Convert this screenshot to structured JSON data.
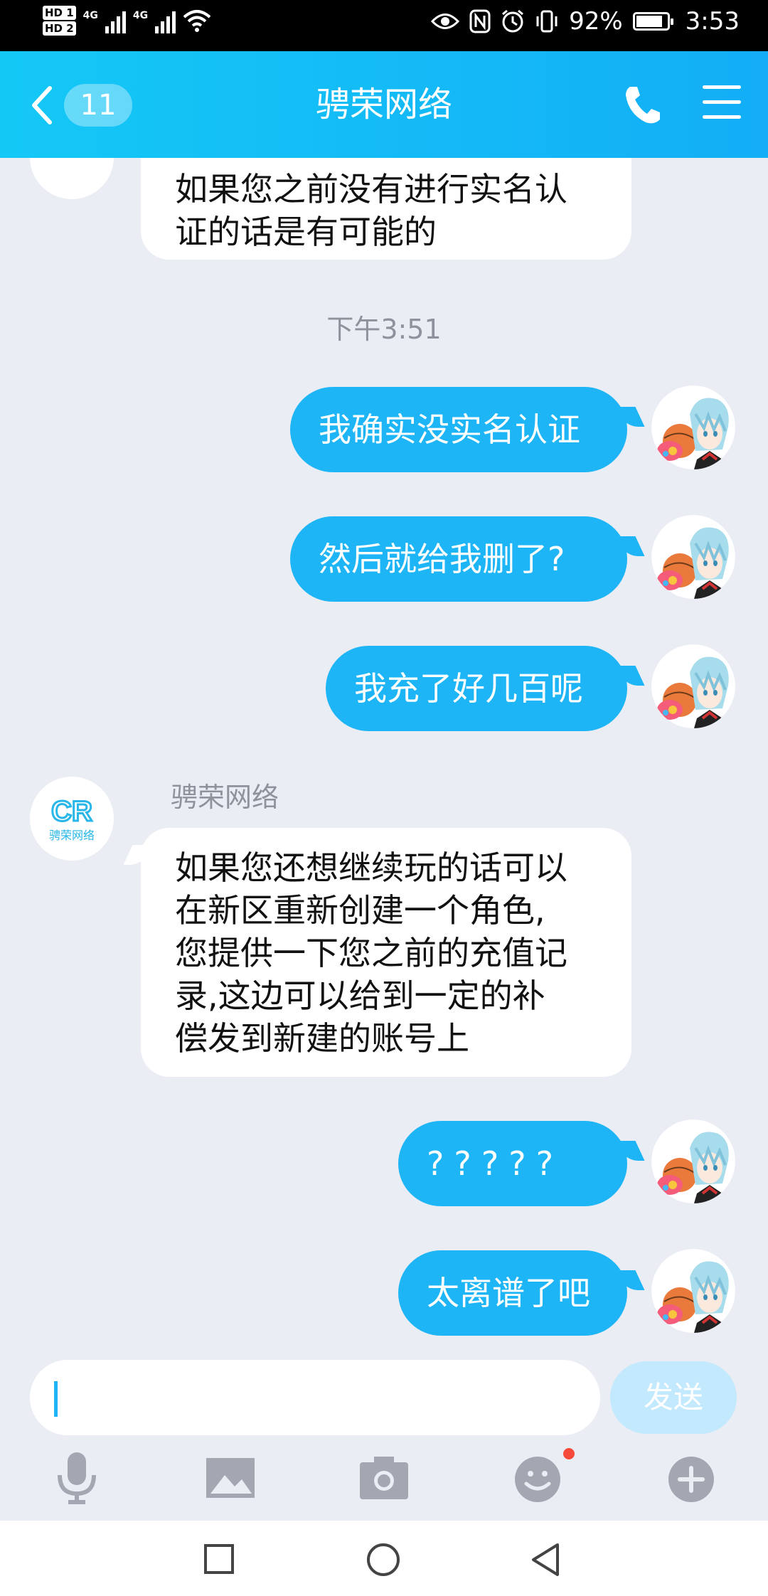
{
  "status_bar": {
    "sim1_label": "HD 1",
    "sim2_label": "HD 2",
    "net1": "4G",
    "net2": "4G",
    "battery_percent": "92%",
    "battery_level": 0.92,
    "time": "3:53",
    "icons": [
      "eye-icon",
      "nfc-icon",
      "alarm-icon",
      "vibrate-icon",
      "battery-icon"
    ]
  },
  "header": {
    "unread_count": "11",
    "title": "骋荣网络",
    "icons": [
      "back-arrow-icon",
      "phone-icon",
      "menu-icon"
    ]
  },
  "colors": {
    "header_start": "#14C8F6",
    "header_end": "#13AEF6",
    "outgoing_bubble": "#1EB5F7",
    "incoming_bubble": "#FFFFFF",
    "chat_background": "#EBEDF5",
    "send_button_disabled": "#C2E9FD",
    "notification_dot": "#F84A3A"
  },
  "messages": {
    "m0": {
      "side": "incoming",
      "lines": [
        "如果您之前没有进行实名认",
        "证的话是有可能的"
      ]
    },
    "time_label": "下午3:51",
    "m1": {
      "side": "outgoing",
      "text": "我确实没实名认证"
    },
    "m2": {
      "side": "outgoing",
      "text": "然后就给我删了?"
    },
    "m3": {
      "side": "outgoing",
      "text": "我充了好几百呢"
    },
    "m4": {
      "side": "incoming",
      "sender": "骋荣网络",
      "lines": [
        "如果您还想继续玩的话可以",
        "在新区重新创建一个角色,",
        "您提供一下您之前的充值记",
        "录,这边可以给到一定的补",
        "偿发到新建的账号上"
      ]
    },
    "m5": {
      "side": "outgoing",
      "text": "?????"
    },
    "m6": {
      "side": "outgoing",
      "text": "太离谱了吧"
    }
  },
  "company_logo": {
    "letters": "CR",
    "caption": "骋荣网络"
  },
  "input": {
    "value": "",
    "send_label": "发送"
  },
  "toolbar": {
    "icons": [
      "microphone-icon",
      "image-icon",
      "camera-icon",
      "emoji-icon",
      "plus-icon"
    ],
    "emoji_has_notification": true
  },
  "nav_bar": {
    "icons": [
      "recent-apps-icon",
      "home-icon",
      "back-icon"
    ]
  }
}
